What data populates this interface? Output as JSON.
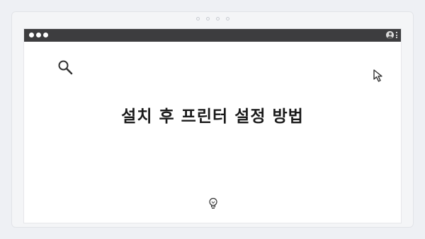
{
  "frame": {
    "accent_dark": "#3d3d3f",
    "background": "#ffffff"
  },
  "toolbar": {
    "window_controls": [
      "close-dot",
      "minimize-dot",
      "maximize-dot"
    ],
    "right_icons": [
      "user-icon",
      "kebab-menu-icon"
    ]
  },
  "icons": {
    "search": "search-icon",
    "cursor": "cursor-icon",
    "bulb": "lightbulb-icon"
  },
  "main": {
    "title": "설치 후 프린터 설정 방법"
  }
}
